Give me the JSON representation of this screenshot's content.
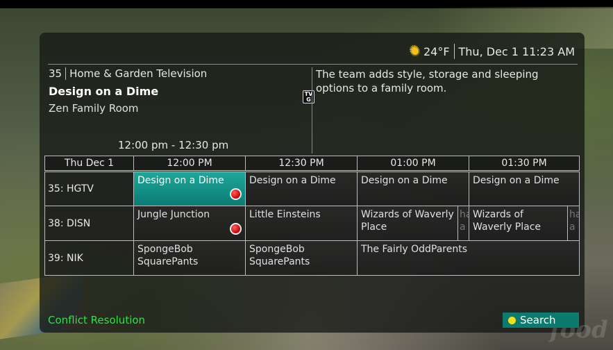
{
  "weather": {
    "temperature": "24°F",
    "icon": "sun-icon"
  },
  "datetime": "Thu, Dec 1 11:23 AM",
  "info": {
    "channel_number": "35",
    "channel_name": "Home & Garden Television",
    "program_title": "Design on a Dime",
    "episode_title": "Zen Family Room",
    "time_range": "12:00 pm - 12:30 pm",
    "rating_top": "TV",
    "rating_bottom": "G",
    "description": "The team adds style, storage and sleeping options to a family room."
  },
  "grid": {
    "date_label": "Thu Dec 1",
    "times": [
      "12:00 PM",
      "12:30 PM",
      "01:00 PM",
      "01:30 PM"
    ],
    "rows": [
      {
        "channel": "35: HGTV",
        "programs": [
          {
            "title": "Design on a Dime",
            "selected": true,
            "record": true
          },
          {
            "title": "Design on a Dime"
          },
          {
            "title": "Design on a Dime"
          },
          {
            "title": "Design on a Dime"
          }
        ]
      },
      {
        "channel": "38: DISN",
        "programs": [
          {
            "title": "Jungle Junction",
            "record": true
          },
          {
            "title": "Little Einsteins"
          },
          {
            "title": "Wizards of Waverly Place"
          },
          {
            "title": "ha a"
          },
          {
            "title": "Wizards of Waverly Place"
          },
          {
            "title": "ha a"
          }
        ]
      },
      {
        "channel": "39: NIK",
        "programs": [
          {
            "title": "SpongeBob SquarePants"
          },
          {
            "title": "SpongeBob SquarePants"
          },
          {
            "title": "The Fairly OddParents"
          }
        ]
      }
    ]
  },
  "footer": {
    "left_label": "Conflict Resolution",
    "right_label": "Search",
    "left_color": "#2fe04a",
    "right_bg": "#0d7a70"
  },
  "watermark": "food"
}
